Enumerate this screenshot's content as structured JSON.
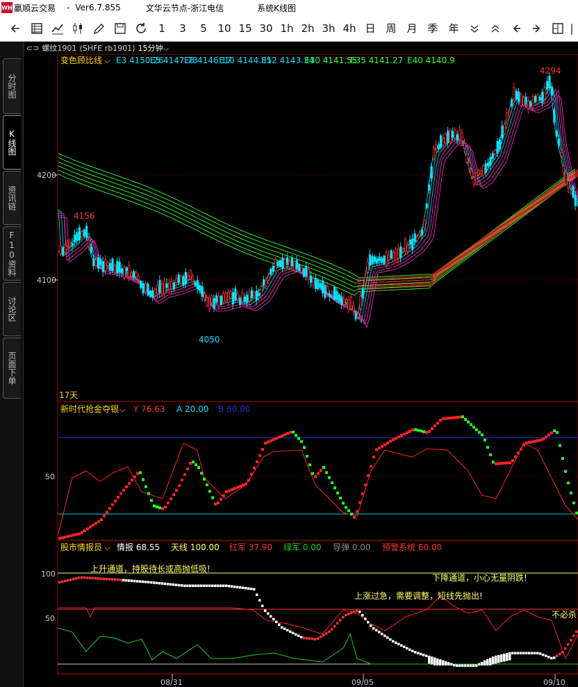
{
  "titlebar": {
    "logo": "WH",
    "app_name": "赢顺云交易",
    "sep": "-",
    "version": "Ver6.7.855",
    "node": "文华云节点-浙江电信",
    "menu": "系统K线图"
  },
  "toolbar": {
    "periods": [
      "1",
      "3",
      "5",
      "10",
      "15",
      "30",
      "1h",
      "2h",
      "3h",
      "4h",
      "日",
      "周",
      "月",
      "季",
      "年"
    ]
  },
  "sidebar": {
    "tabs": [
      "分时图",
      "K线图",
      "资讯链",
      "F10资料",
      "讨论区",
      "页面下单"
    ],
    "active": "K线图"
  },
  "header": {
    "link_icon": "⊂⊃",
    "symbol": "螺纹1901",
    "code": "(SHFE rb1901)",
    "period": "15分钟"
  },
  "main": {
    "indicator": "变色顾比线",
    "ema": [
      {
        "label": "E3 4150.26",
        "color": "#00e5ff"
      },
      {
        "label": "E5 4147.73",
        "color": "#00e5ff"
      },
      {
        "label": "E8 4146.17",
        "color": "#00e5ff"
      },
      {
        "label": "E10 4144.85",
        "color": "#00e5ff"
      },
      {
        "label": "E12 4143.34",
        "color": "#00e5ff"
      },
      {
        "label": "E30 4141.55",
        "color": "#33ff33"
      },
      {
        "label": "E35 4141.27",
        "color": "#33ff33"
      },
      {
        "label": "E40 4140.9",
        "color": "#33ff33"
      }
    ],
    "y_ticks": [
      "4200",
      "4100"
    ],
    "high_label": "4294",
    "left_high_label": "4156",
    "low_label": "4050",
    "days_label": "17天"
  },
  "sub1": {
    "indicator": "新时代抢金夺银",
    "y": "Y 76.63",
    "a": "A 20.00",
    "b": "B 80.00",
    "tick": "50"
  },
  "sub2": {
    "indicator": "股市情报员",
    "info": "情报 68.55",
    "sky": "天线 100.00",
    "red": "红军 37.90",
    "green": "绿军 0.00",
    "guide": "导弹 0.00",
    "warn": "预警系统 60.00",
    "ticks": [
      "100",
      "50"
    ],
    "msg_up": "上升通道，持股待长或高抛低吸!",
    "msg_down": "下降通道，小心无量阴跌!",
    "msg_over": "上涨过急，需要调整，短线先抛出!",
    "msg_right": "不必杀"
  },
  "xaxis": [
    "08/31",
    "09/05",
    "09/10"
  ],
  "colors": {
    "up": "#ff3333",
    "down": "#00e5ff",
    "grid": "#8b0000",
    "panel_border": "#aa0000",
    "ema_short": "#00e5ff",
    "ema_long": "#33ff33"
  }
}
